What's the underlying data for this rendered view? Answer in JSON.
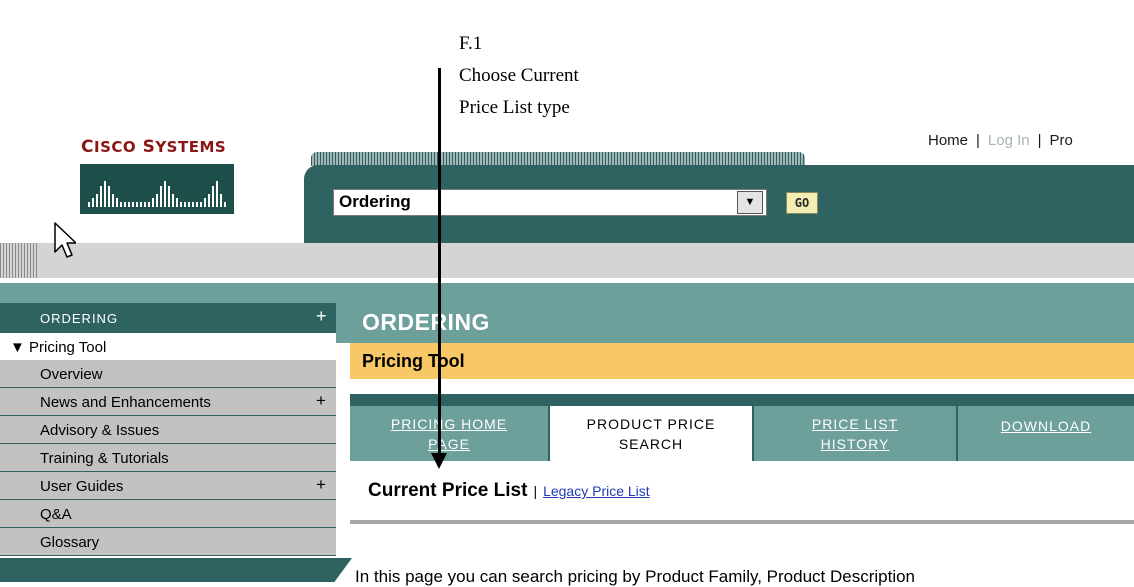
{
  "annotation": {
    "id": "F.1",
    "line1": "Choose Current",
    "line2": "Price List type"
  },
  "logo": {
    "cap1": "C",
    "rest1": "ISCO",
    "cap2": "S",
    "rest2": "YSTEMS"
  },
  "top_links": {
    "home": "Home",
    "login": "Log In",
    "profile": "Pro"
  },
  "header": {
    "select_value": "Ordering",
    "go_label": "GO"
  },
  "sidebar": {
    "title": "ORDERING",
    "title_plus": "+",
    "pricing_tool": "Pricing Tool",
    "items": [
      {
        "label": "Overview",
        "plus": ""
      },
      {
        "label": "News and Enhancements",
        "plus": "+"
      },
      {
        "label": "Advisory & Issues",
        "plus": ""
      },
      {
        "label": "Training & Tutorials",
        "plus": ""
      },
      {
        "label": "User Guides",
        "plus": "+"
      },
      {
        "label": "Q&A",
        "plus": ""
      },
      {
        "label": "Glossary",
        "plus": ""
      }
    ]
  },
  "main": {
    "heading": "ORDERING",
    "section": "Pricing Tool",
    "tabs": [
      {
        "line1": "PRICING HOME",
        "line2": "PAGE"
      },
      {
        "line1": "PRODUCT PRICE",
        "line2": "SEARCH"
      },
      {
        "line1": "PRICE LIST",
        "line2": "HISTORY"
      },
      {
        "line1": "DOWNLOAD",
        "line2": ""
      }
    ],
    "current_price_list": "Current Price List",
    "separator": "|",
    "legacy_link": "Legacy Price List",
    "intro": "In this page you can search pricing by Product Family, Product Description"
  },
  "colors": {
    "teal_dark": "#2f6362",
    "teal_light": "#6d9f9b",
    "pricing_bar": "#f8c867",
    "logo_red": "#8b1414",
    "link_blue": "#1f3bb5"
  }
}
